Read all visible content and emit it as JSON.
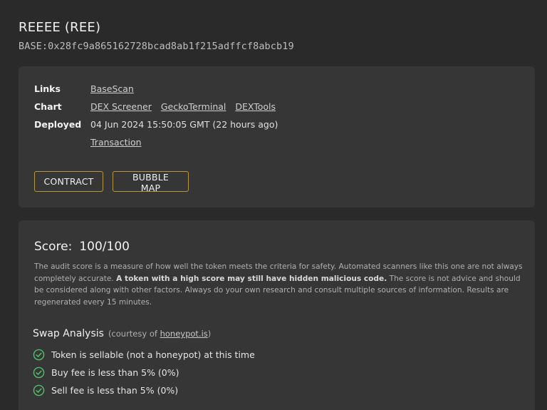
{
  "token": {
    "title": "REEEE (REE)",
    "address": "BASE:0x28fc9a865162728bcad8ab1f215adffcf8abcb19"
  },
  "info": {
    "links_label": "Links",
    "links": [
      "BaseScan"
    ],
    "chart_label": "Chart",
    "chart_links": [
      "DEX Screener",
      "GeckoTerminal",
      "DEXTools"
    ],
    "deployed_label": "Deployed",
    "deployed_value": "04 Jun 2024 15:50:05 GMT (22 hours ago)",
    "transaction_link": "Transaction"
  },
  "buttons": {
    "contract": "CONTRACT",
    "bubble_map": "BUBBLE MAP"
  },
  "score": {
    "label": "Score:",
    "value": "100/100",
    "desc_part1": "The audit score is a measure of how well the token meets the criteria for safety.  Automated scanners like this one are not always completely accurate. ",
    "desc_bold": "A token with a high score may still have hidden malicious code.",
    "desc_part2": " The score is not advice and should be considered along with other factors. Always do your own research and consult multiple sources of information.  Results are regenerated every 15 minutes."
  },
  "swap": {
    "heading": "Swap Analysis",
    "courtesy_prefix": "(courtesy of ",
    "courtesy_link": "honeypot.is",
    "courtesy_suffix": ")",
    "checks": [
      "Token is sellable (not a honeypot) at this time",
      "Buy fee is less than 5% (0%)",
      "Sell fee is less than 5% (0%)"
    ]
  },
  "colors": {
    "background": "#2a2a2a",
    "card": "#363636",
    "button_border": "#b8963a",
    "check_green": "#4fbf6a"
  },
  "icons": {
    "check": "check-circle-icon"
  }
}
